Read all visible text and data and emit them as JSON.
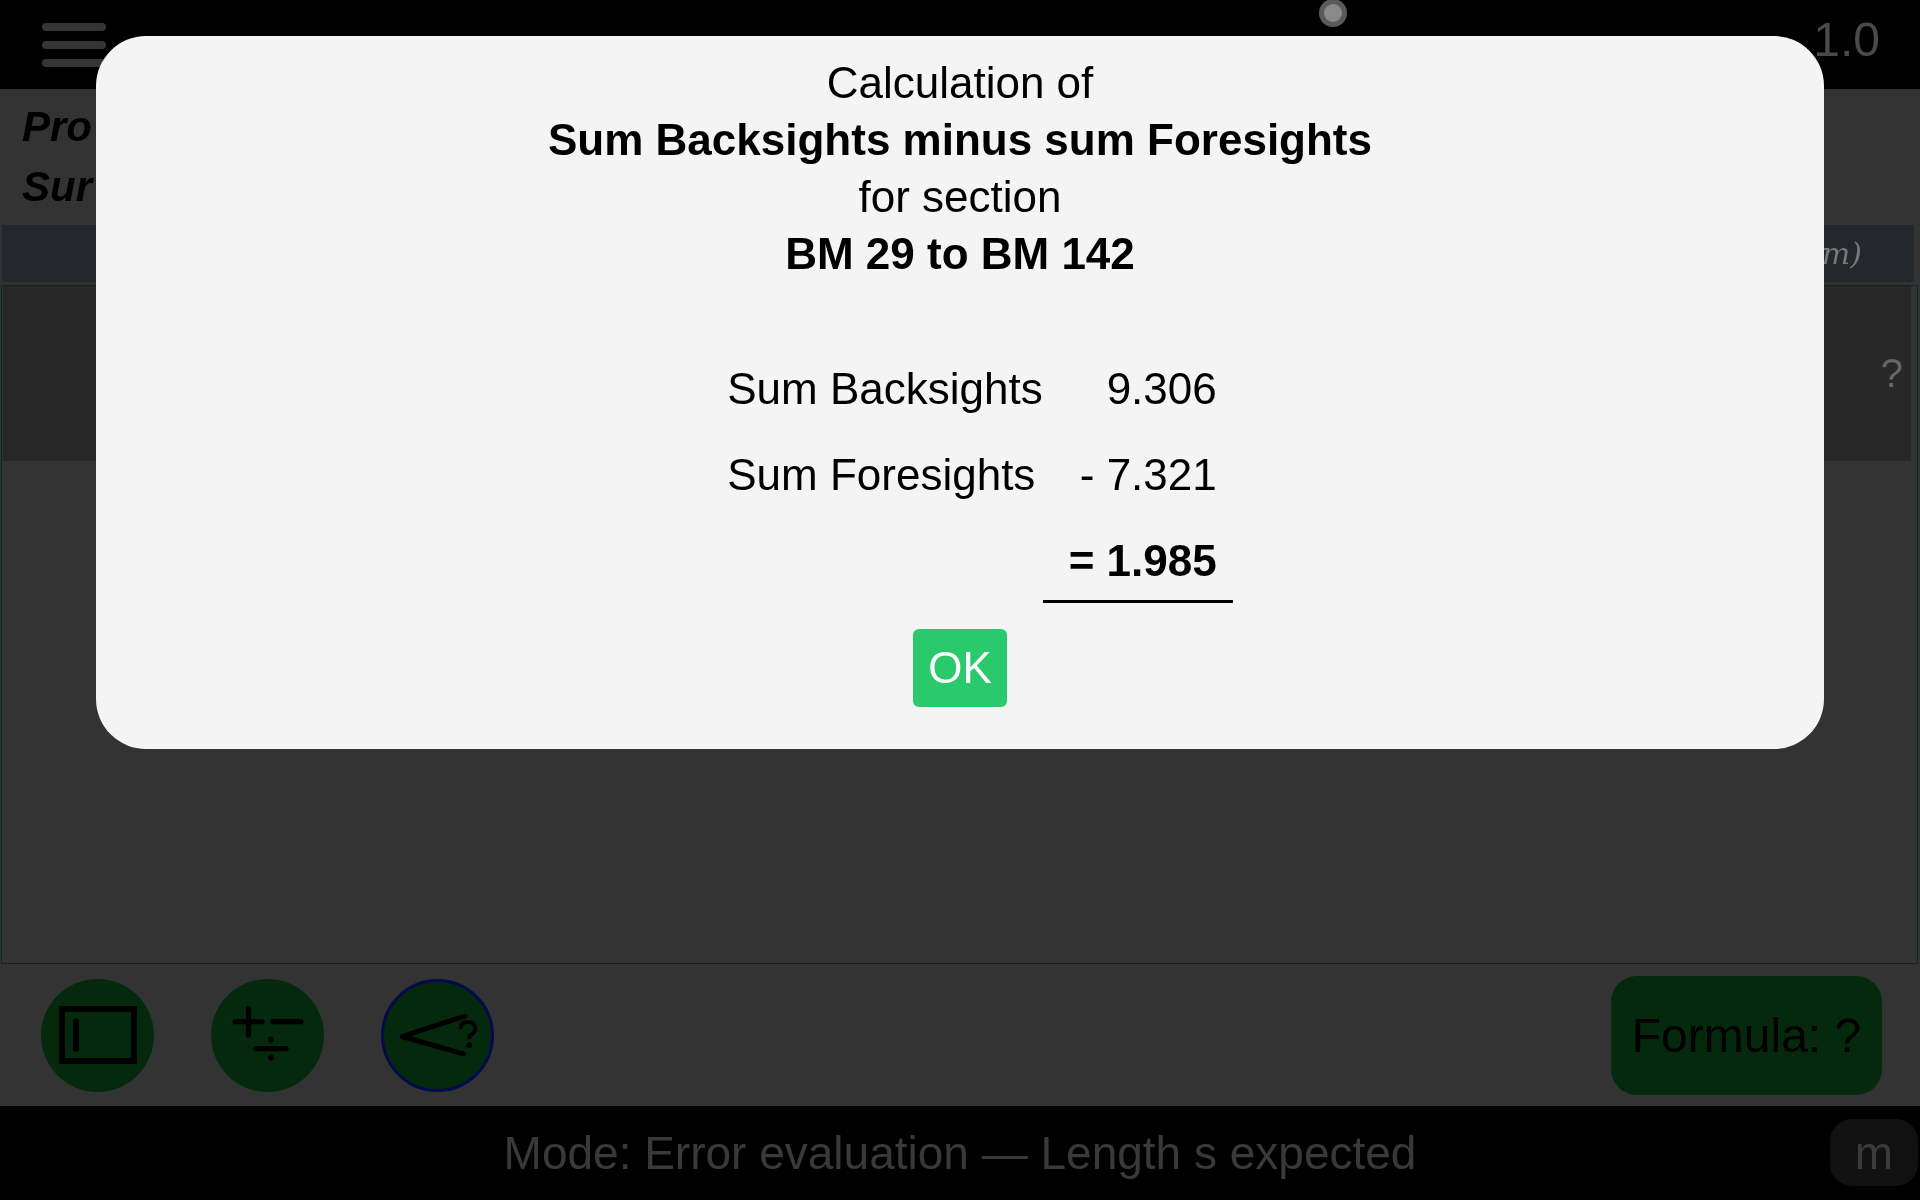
{
  "top_bar": {
    "title": "1.0"
  },
  "header": {
    "lines": [
      "Pro",
      "Sur"
    ]
  },
  "table": {
    "header_fragment": "m)",
    "cell": "?"
  },
  "toolbar": {
    "tools": [
      {
        "kind": "rectangle",
        "selected": false
      },
      {
        "kind": "arithmetic",
        "selected": false
      },
      {
        "kind": "angle",
        "selected": true
      }
    ],
    "formula_button": "Formula: ?"
  },
  "status_bar": {
    "mode": "Mode: Error evaluation — Length s expected",
    "unit_button": "m"
  },
  "dialog": {
    "title_lines": [
      {
        "text": "Calculation of",
        "bold": false
      },
      {
        "text": "Sum Backsights minus sum Foresights",
        "bold": true
      },
      {
        "text": "for section",
        "bold": false
      },
      {
        "text": "BM 29 to BM 142",
        "bold": true
      }
    ],
    "rows": [
      {
        "label": "Sum Backsights",
        "value": "9.306"
      },
      {
        "label": "Sum Foresights",
        "value": "- 7.321"
      }
    ],
    "result": "= 1.985",
    "ok_button": "OK"
  }
}
